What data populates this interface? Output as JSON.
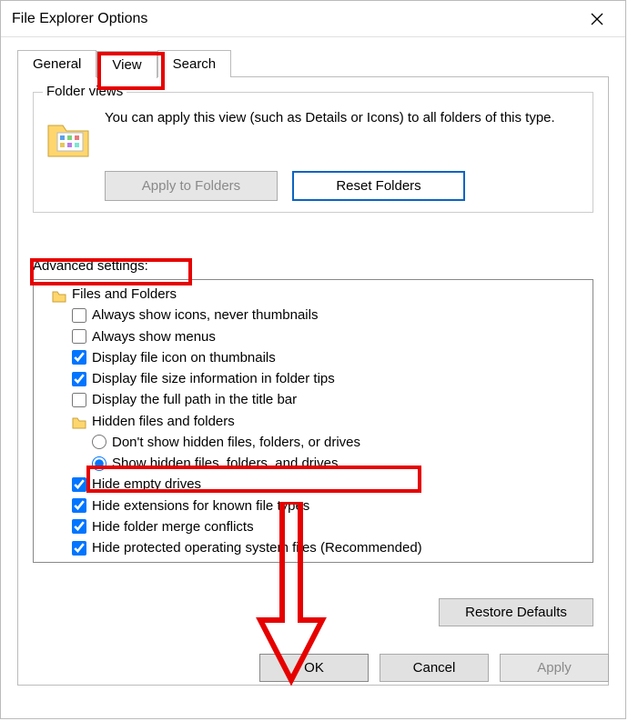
{
  "window": {
    "title": "File Explorer Options"
  },
  "tabs": {
    "general": "General",
    "view": "View",
    "search": "Search",
    "active": "view"
  },
  "folder_views": {
    "group_label": "Folder views",
    "description": "You can apply this view (such as Details or Icons) to all folders of this type.",
    "apply_label": "Apply to Folders",
    "reset_label": "Reset Folders"
  },
  "advanced": {
    "label": "Advanced settings:",
    "root": "Files and Folders",
    "items": [
      {
        "type": "checkbox",
        "checked": false,
        "label": "Always show icons, never thumbnails"
      },
      {
        "type": "checkbox",
        "checked": false,
        "label": "Always show menus"
      },
      {
        "type": "checkbox",
        "checked": true,
        "label": "Display file icon on thumbnails"
      },
      {
        "type": "checkbox",
        "checked": true,
        "label": "Display file size information in folder tips"
      },
      {
        "type": "checkbox",
        "checked": false,
        "label": "Display the full path in the title bar"
      }
    ],
    "hidden_group": "Hidden files and folders",
    "hidden_options": [
      {
        "checked": false,
        "label": "Don't show hidden files, folders, or drives"
      },
      {
        "checked": true,
        "label": "Show hidden files, folders, and drives"
      }
    ],
    "items_after": [
      {
        "type": "checkbox",
        "checked": true,
        "label": "Hide empty drives"
      },
      {
        "type": "checkbox",
        "checked": true,
        "label": "Hide extensions for known file types"
      },
      {
        "type": "checkbox",
        "checked": true,
        "label": "Hide folder merge conflicts"
      },
      {
        "type": "checkbox",
        "checked": true,
        "label": "Hide protected operating system files (Recommended)"
      }
    ]
  },
  "buttons": {
    "restore_defaults": "Restore Defaults",
    "ok": "OK",
    "cancel": "Cancel",
    "apply": "Apply"
  },
  "highlights": {
    "color": "#e60000"
  }
}
